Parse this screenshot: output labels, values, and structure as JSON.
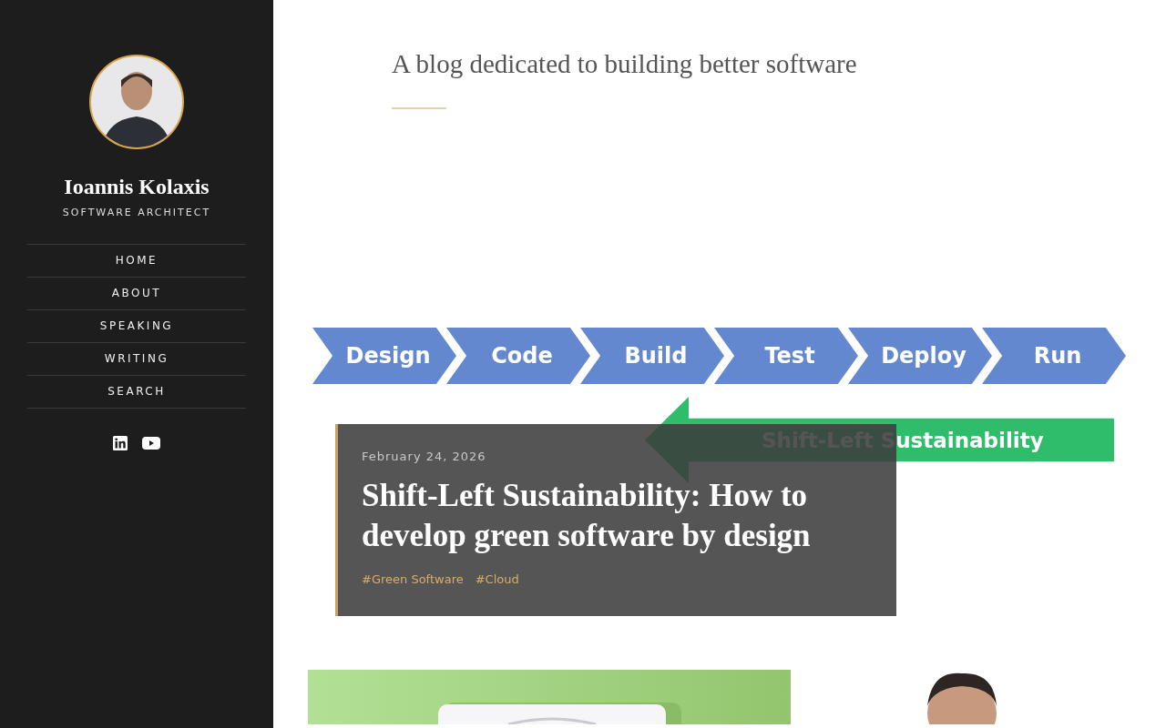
{
  "sidebar": {
    "name": "Ioannis Kolaxis",
    "role": "SOFTWARE ARCHITECT",
    "nav": [
      {
        "label": "HOME"
      },
      {
        "label": "ABOUT"
      },
      {
        "label": "SPEAKING"
      },
      {
        "label": "WRITING"
      },
      {
        "label": "SEARCH"
      }
    ]
  },
  "header": {
    "tagline": "A blog dedicated to building better software"
  },
  "featured_post": {
    "diagram": {
      "steps": [
        "Design",
        "Code",
        "Build",
        "Test",
        "Deploy",
        "Run"
      ],
      "arrow_label": "Shift-Left Sustainability"
    },
    "date": "February 24, 2026",
    "title": "Shift-Left Sustainability: How to develop green software by design",
    "tags": [
      "#Green Software",
      "#Cloud"
    ]
  }
}
